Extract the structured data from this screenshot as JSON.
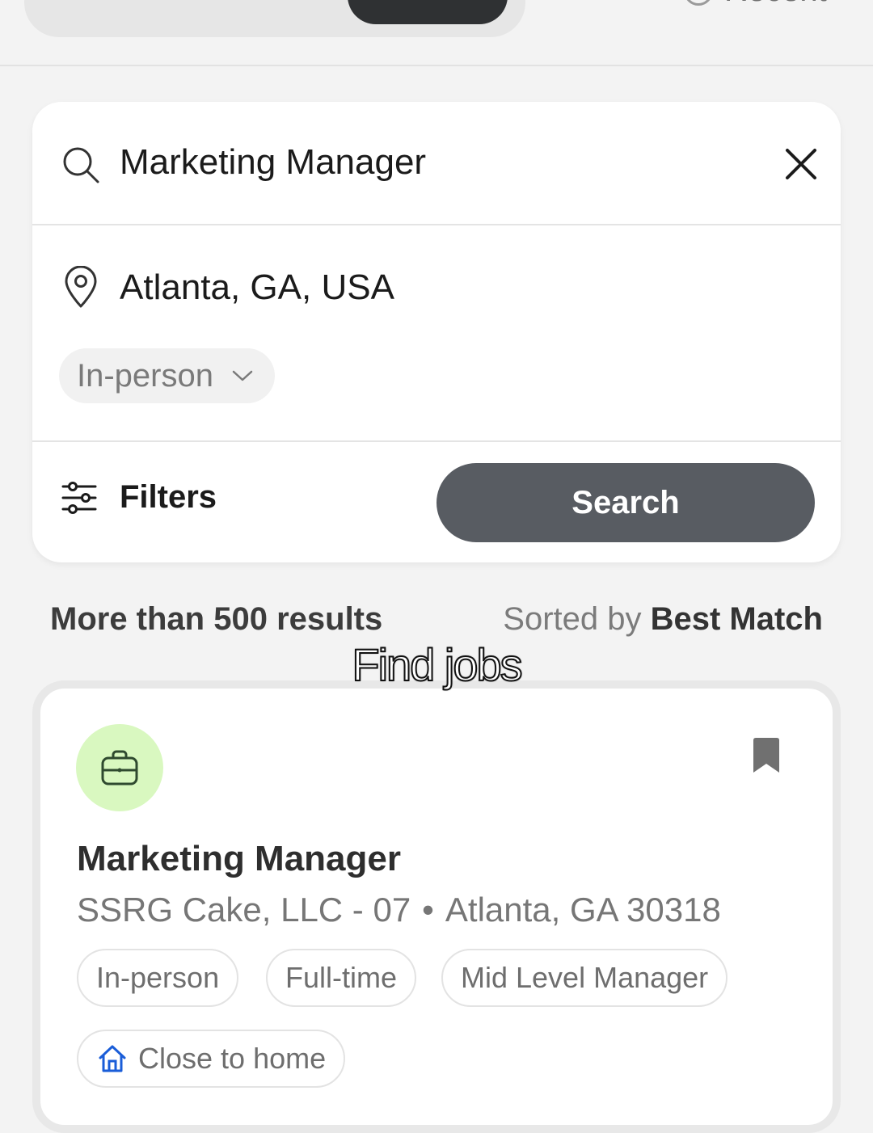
{
  "top_tabs": {
    "recent_label": "Recent"
  },
  "search": {
    "keyword": "Marketing Manager",
    "location": "Atlanta, GA, USA",
    "work_type": "In-person",
    "filters_label": "Filters",
    "search_button_label": "Search"
  },
  "results": {
    "count_label": "More than 500 results",
    "sort_prefix": "Sorted by",
    "sort_value": "Best Match"
  },
  "caption": "Find jobs",
  "job": {
    "title": "Marketing Manager",
    "company": "SSRG Cake, LLC - 07",
    "separator": "•",
    "location": "Atlanta, GA 30318",
    "tags": [
      "In-person",
      "Full-time",
      "Mid Level Manager"
    ],
    "commute_tag": "Close to home"
  },
  "colors": {
    "search_button": "#585c62",
    "logo_background": "#d9f8c0",
    "home_icon": "#1a5dd8"
  },
  "icons": [
    "search-icon",
    "close-icon",
    "location-pin-icon",
    "chevron-down-icon",
    "filters-icon",
    "briefcase-icon",
    "bookmark-icon",
    "home-icon",
    "clock-icon"
  ]
}
